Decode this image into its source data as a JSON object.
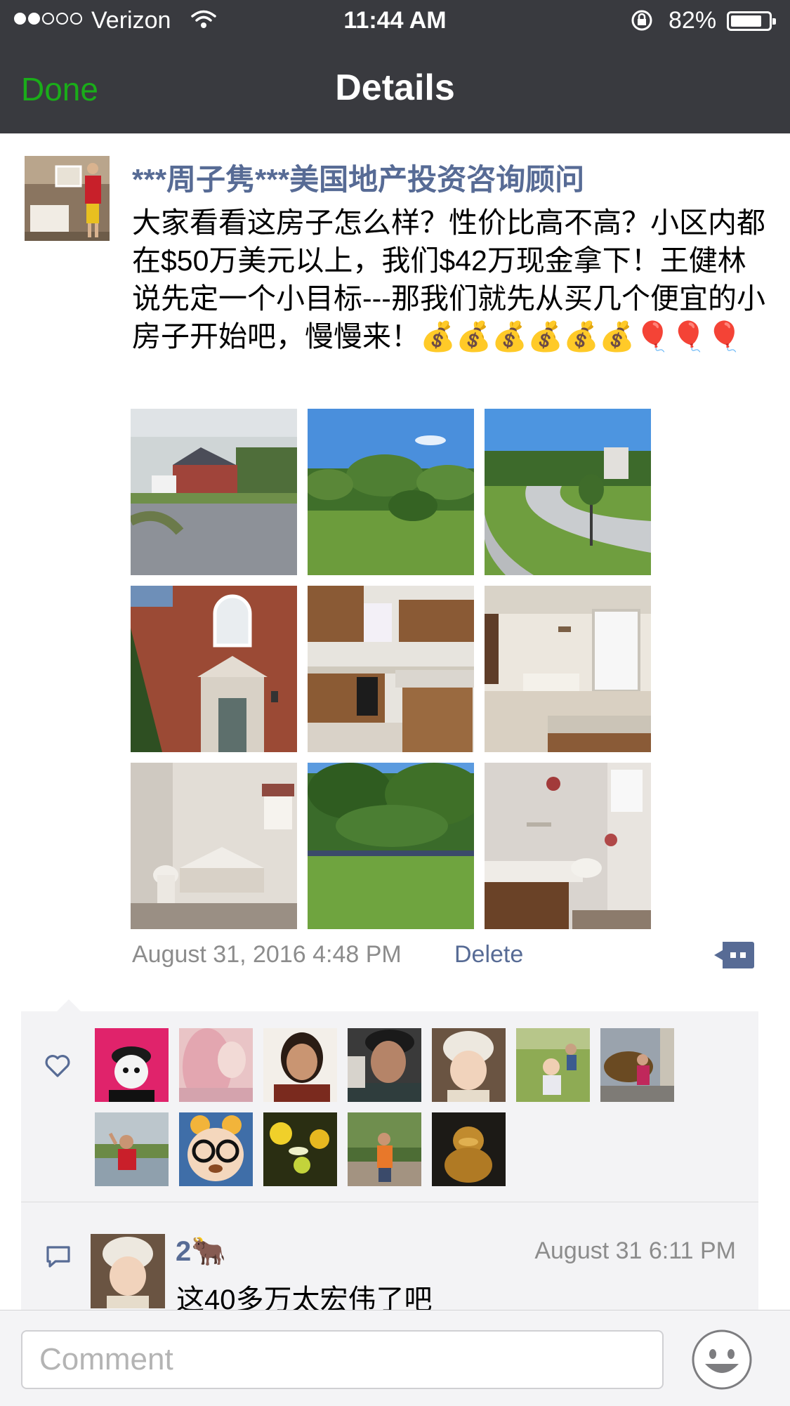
{
  "status_bar": {
    "carrier": "Verizon",
    "time": "11:44 AM",
    "battery_percent": "82%",
    "battery_level": 0.82,
    "signal_bars": 2
  },
  "nav": {
    "done_label": "Done",
    "title": "Details"
  },
  "post": {
    "author": "***周子隽***美国地产投资咨询顾问",
    "text": "大家看看这房子怎么样？性价比高不高？小区内都在$50万美元以上，我们$42万现金拿下！王健林说先定一个小目标---那我们就先从买几个便宜的小房子开始吧，慢慢来！💰💰💰💰💰💰🎈🎈🎈",
    "photo_count": 9,
    "timestamp": "August 31, 2016 4:48 PM",
    "delete_label": "Delete"
  },
  "likes": {
    "count": 12
  },
  "comments": [
    {
      "name": "2🐂",
      "time": "August 31 6:11 PM",
      "text": "这40多万太宏伟了吧"
    }
  ],
  "comment_bar": {
    "placeholder": "Comment"
  },
  "colors": {
    "nav_background": "#393a3f",
    "done_green": "#1aad19",
    "link_blue": "#576b95",
    "panel_gray": "#f3f3f5"
  }
}
